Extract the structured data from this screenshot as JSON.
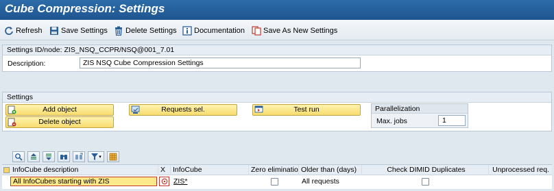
{
  "window": {
    "title": "Cube Compression: Settings"
  },
  "toolbar": {
    "refresh": "Refresh",
    "save_settings": "Save Settings",
    "delete_settings": "Delete Settings",
    "documentation": "Documentation",
    "save_as_new": "Save As New Settings"
  },
  "header_panel": {
    "settings_id_label": "Settings ID/node:",
    "settings_id_value": "ZIS_NSQ_CCPR/NSQ@001_7.01",
    "description_label": "Description:",
    "description_value": "ZIS NSQ Cube Compression Settings"
  },
  "settings_panel": {
    "title": "Settings",
    "add_object": "Add object",
    "delete_object": "Delete object",
    "requests_sel": "Requests sel.",
    "test_run": "Test run",
    "parallelization": {
      "title": "Parallelization",
      "max_jobs_label": "Max. jobs",
      "max_jobs_value": "1"
    }
  },
  "grid": {
    "columns": [
      "InfoCube description",
      "X",
      "InfoCube",
      "Zero elimination",
      "Older than (days)",
      "Check DIMID Duplicates",
      "Unprocessed req."
    ],
    "rows": [
      {
        "description": "All InfoCubes starting with ZIS",
        "infocube": "ZIS*",
        "zero_elimination": false,
        "older_than": "All requests",
        "check_dimid": false
      }
    ]
  },
  "colors": {
    "title_bar": "#1f5590",
    "button_yellow": "#f8dc6e",
    "panel_bg": "#ffffff",
    "page_bg": "#dfe7ef"
  }
}
